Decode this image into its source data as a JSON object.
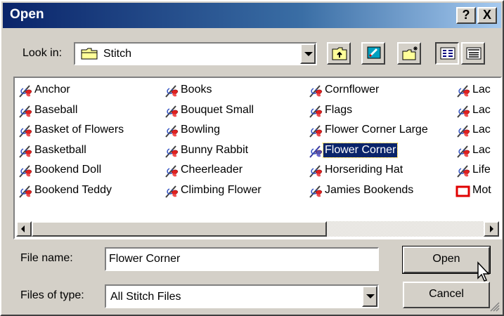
{
  "window": {
    "title": "Open"
  },
  "title_buttons": {
    "help": "?",
    "close": "X"
  },
  "look_in": {
    "label": "Look in:",
    "value": "Stitch"
  },
  "toolbar": [
    "up-folder-icon",
    "desktop-icon",
    "new-folder-icon",
    "list-view-icon",
    "details-view-icon"
  ],
  "files": {
    "col1": [
      "Anchor",
      "Baseball",
      "Basket of Flowers",
      "Basketball",
      "Bookend Doll",
      "Bookend Teddy"
    ],
    "col2": [
      "Books",
      "Bouquet Small",
      "Bowling",
      "Bunny Rabbit",
      "Cheerleader",
      "Climbing Flower"
    ],
    "col3": [
      "Cornflower",
      "Flags",
      "Flower Corner Large",
      "Flower Corner",
      "Horseriding Hat",
      "Jamies Bookends"
    ],
    "col4": [
      "Lac",
      "Lac",
      "Lac",
      "Lac",
      "Life",
      "Mot"
    ]
  },
  "selected_file": "Flower Corner",
  "file_name": {
    "label": "File name:",
    "value": "Flower Corner"
  },
  "file_type": {
    "label": "Files of type:",
    "value": "All Stitch Files"
  },
  "buttons": {
    "open": "Open",
    "cancel": "Cancel"
  },
  "colors": {
    "title_start": "#0a246a",
    "title_end": "#a6caf0",
    "face": "#d4d0c8",
    "selection": "#0a246a"
  }
}
